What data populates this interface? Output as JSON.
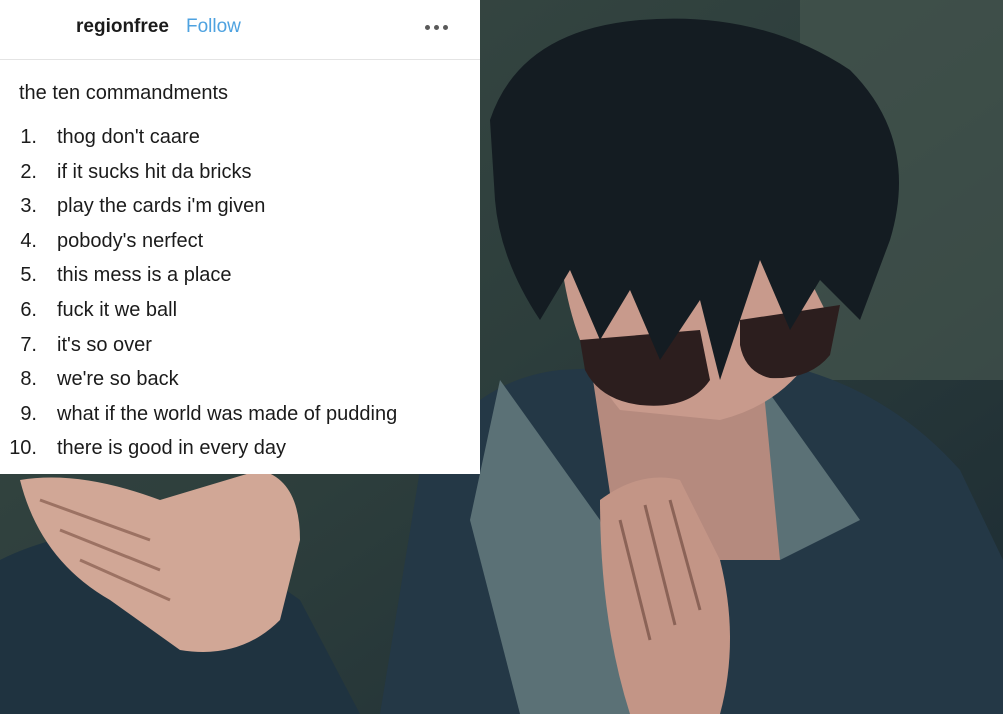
{
  "post": {
    "username": "regionfree",
    "follow_label": "Follow",
    "title": "the ten commandments",
    "items": [
      {
        "num": "1.",
        "text": "thog don't caare"
      },
      {
        "num": "2.",
        "text": "if it sucks hit da bricks"
      },
      {
        "num": "3.",
        "text": "play the cards i'm given"
      },
      {
        "num": "4.",
        "text": "pobody's nerfect"
      },
      {
        "num": "5.",
        "text": "this mess is a place"
      },
      {
        "num": "6.",
        "text": "fuck it we ball"
      },
      {
        "num": "7.",
        "text": "it's so over"
      },
      {
        "num": "8.",
        "text": "we're so back"
      },
      {
        "num": "9.",
        "text": "what if the world was made of pudding"
      },
      {
        "num": "10.",
        "text": "there is good in every day"
      }
    ]
  },
  "colors": {
    "follow": "#4ea2e0",
    "card_bg": "#ffffff",
    "scene_bg": "#1f3038"
  }
}
